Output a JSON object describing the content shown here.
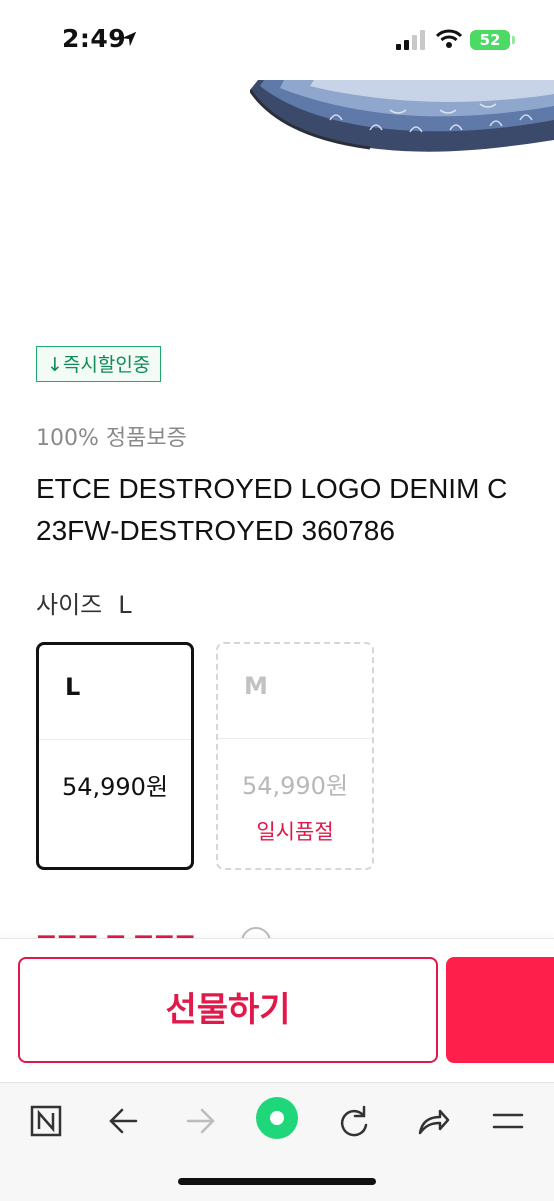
{
  "status_bar": {
    "time": "2:49",
    "battery": "52"
  },
  "product": {
    "badge": "↓즉시할인중",
    "authenticity": "100% 정품보증",
    "title_line1": "ETCE DESTROYED LOGO DENIM C",
    "title_line2": "23FW-DESTROYED 360786",
    "size_label": "사이즈",
    "selected_size": "L"
  },
  "size_options": [
    {
      "code": "L",
      "price": "54,990원",
      "status": "",
      "selected": true
    },
    {
      "code": "M",
      "price": "54,990원",
      "status": "일시품절",
      "selected": false
    }
  ],
  "action_bar": {
    "gift_label": "선물하기",
    "buy_label": ""
  },
  "colors": {
    "accent": "#ff1f4b",
    "accent_text": "#e0194a",
    "badge_green": "#1ba86a"
  },
  "toolbar": {
    "icons": [
      "naver-n-icon",
      "back-arrow-icon",
      "forward-arrow-icon",
      "green-dot-icon",
      "refresh-icon",
      "share-icon",
      "menu-icon"
    ]
  }
}
